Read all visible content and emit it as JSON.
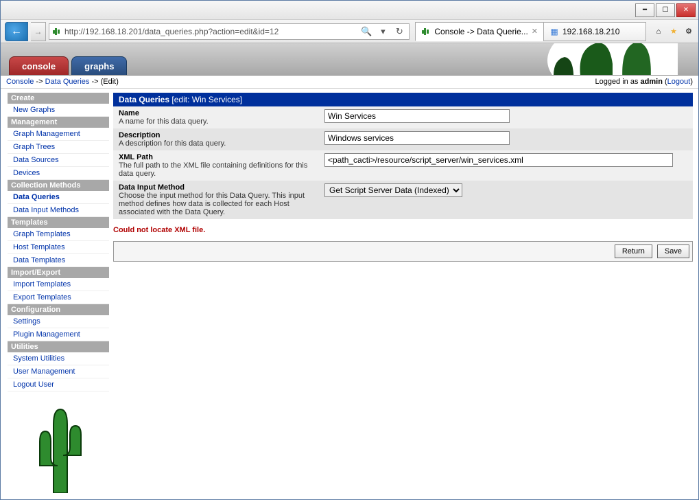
{
  "browser": {
    "url": "http://192.168.18.201/data_queries.php?action=edit&id=12",
    "tabs": [
      {
        "title": "Console -> Data Querie...",
        "active": true
      },
      {
        "title": "192.168.18.210",
        "active": false
      }
    ]
  },
  "breadcrumb": {
    "console": "Console",
    "section": "Data Queries",
    "tail": "(Edit)",
    "logged_in_prefix": "Logged in as ",
    "user": "admin",
    "logout": "Logout"
  },
  "tabs": {
    "console": "console",
    "graphs": "graphs"
  },
  "sidebar": {
    "groups": [
      {
        "title": "Create",
        "items": [
          {
            "label": "New Graphs"
          }
        ]
      },
      {
        "title": "Management",
        "items": [
          {
            "label": "Graph Management"
          },
          {
            "label": "Graph Trees"
          },
          {
            "label": "Data Sources"
          },
          {
            "label": "Devices"
          }
        ]
      },
      {
        "title": "Collection Methods",
        "items": [
          {
            "label": "Data Queries",
            "active": true
          },
          {
            "label": "Data Input Methods"
          }
        ]
      },
      {
        "title": "Templates",
        "items": [
          {
            "label": "Graph Templates"
          },
          {
            "label": "Host Templates"
          },
          {
            "label": "Data Templates"
          }
        ]
      },
      {
        "title": "Import/Export",
        "items": [
          {
            "label": "Import Templates"
          },
          {
            "label": "Export Templates"
          }
        ]
      },
      {
        "title": "Configuration",
        "items": [
          {
            "label": "Settings"
          },
          {
            "label": "Plugin Management"
          }
        ]
      },
      {
        "title": "Utilities",
        "items": [
          {
            "label": "System Utilities"
          },
          {
            "label": "User Management"
          },
          {
            "label": "Logout User"
          }
        ]
      }
    ]
  },
  "panel": {
    "title": "Data Queries",
    "subtitle": "[edit: Win Services]"
  },
  "form": {
    "name": {
      "label": "Name",
      "desc": "A name for this data query.",
      "value": "Win Services"
    },
    "description": {
      "label": "Description",
      "desc": "A description for this data query.",
      "value": "Windows services"
    },
    "xml_path": {
      "label": "XML Path",
      "desc": "The full path to the XML file containing definitions for this data query.",
      "value": "<path_cacti>/resource/script_server/win_services.xml"
    },
    "data_input": {
      "label": "Data Input Method",
      "desc": "Choose the input method for this Data Query. This input method defines how data is collected for each Host associated with the Data Query.",
      "value": "Get Script Server Data (Indexed)"
    }
  },
  "error": "Could not locate XML file.",
  "buttons": {
    "return": "Return",
    "save": "Save"
  }
}
